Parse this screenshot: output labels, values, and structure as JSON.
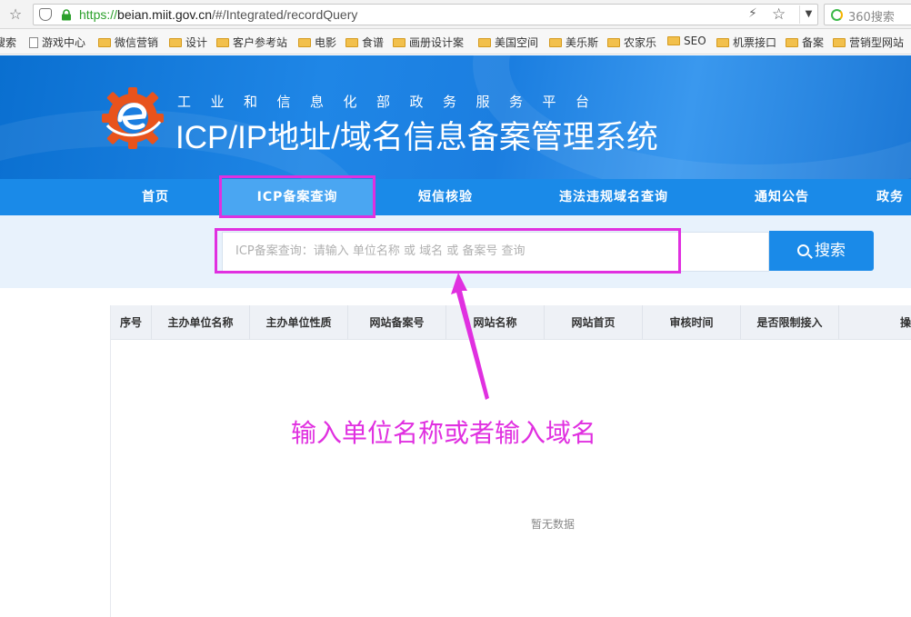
{
  "browser": {
    "url_scheme": "https://",
    "url_host": "beian.miit.gov.cn",
    "url_path": "/#/Integrated/recordQuery",
    "search_engine": "360搜索"
  },
  "bookmarks": [
    {
      "label": "搜索",
      "icon": "none"
    },
    {
      "label": "游戏中心",
      "icon": "doc"
    },
    {
      "label": "微信营销",
      "icon": "folder"
    },
    {
      "label": "设计",
      "icon": "folder"
    },
    {
      "label": "客户参考站",
      "icon": "folder"
    },
    {
      "label": "电影",
      "icon": "folder"
    },
    {
      "label": "食谱",
      "icon": "folder"
    },
    {
      "label": "画册设计案",
      "icon": "folder"
    },
    {
      "label": "美国空间",
      "icon": "folder"
    },
    {
      "label": "美乐斯",
      "icon": "folder"
    },
    {
      "label": "农家乐",
      "icon": "folder"
    },
    {
      "label": "SEO",
      "icon": "folder"
    },
    {
      "label": "机票接口",
      "icon": "folder"
    },
    {
      "label": "备案",
      "icon": "folder"
    },
    {
      "label": "营销型网站",
      "icon": "folder"
    }
  ],
  "header": {
    "subtitle": "工业和信息化部政务服务平台",
    "title": "ICP/IP地址/域名信息备案管理系统"
  },
  "nav": [
    {
      "label": "首页"
    },
    {
      "label": "ICP备案查询",
      "active": true
    },
    {
      "label": "短信核验"
    },
    {
      "label": "违法违规域名查询"
    },
    {
      "label": "通知公告"
    },
    {
      "label": "政务"
    }
  ],
  "search": {
    "placeholder": "ICP备案查询：请输入 单位名称 或 域名 或 备案号 查询",
    "button_label": "搜索"
  },
  "table": {
    "columns": [
      "序号",
      "主办单位名称",
      "主办单位性质",
      "网站备案号",
      "网站名称",
      "网站首页",
      "审核时间",
      "是否限制接入",
      "操"
    ],
    "empty_text": "暂无数据"
  },
  "annotation": {
    "note": "输入单位名称或者输入域名",
    "color": "#e030e0"
  },
  "colors": {
    "nav_bg": "#1a8ae8",
    "nav_active": "#4aa6f2",
    "search_band": "#e8f2fc"
  }
}
